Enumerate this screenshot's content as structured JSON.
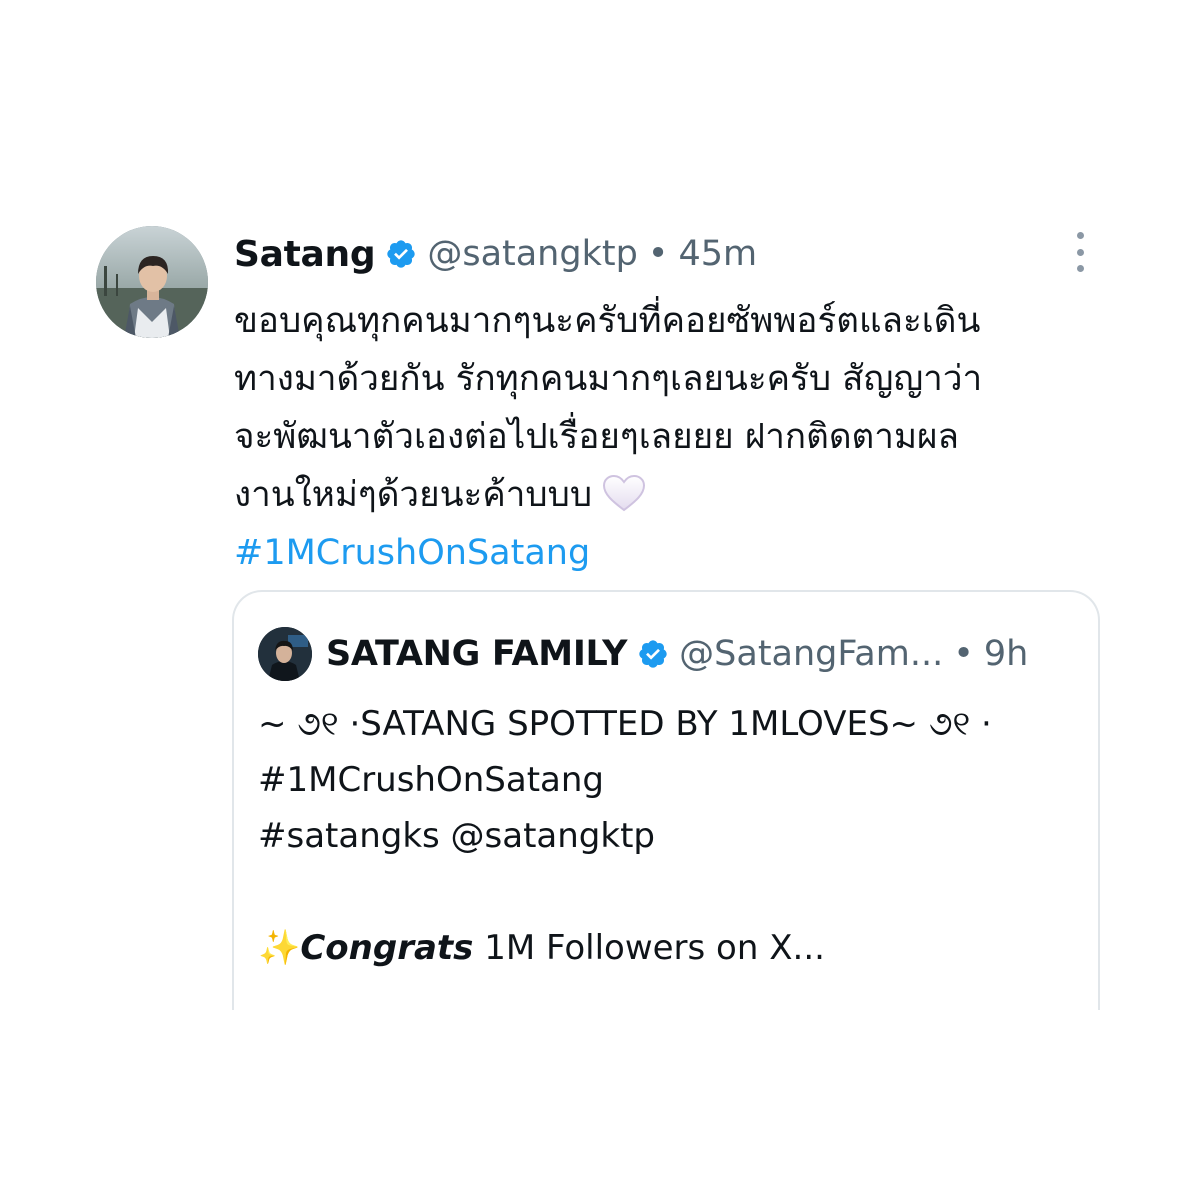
{
  "tweet": {
    "author_name": "Satang",
    "author_handle": "@satangktp",
    "separator": "•",
    "time": "45m",
    "avatar_icon": "profile-photo",
    "verified_icon": "verified-badge-icon",
    "more_icon": "more-options-icon",
    "text_lines": [
      "ขอบคุณทุกคนมากๆนะครับที่คอยซัพพอร์ตและเดิน",
      "ทางมาด้วยกัน รักทุกคนมากๆเลยนะครับ สัญญาว่า",
      "จะพัฒนาตัวเองต่อไปเรื่อยๆเลยยย ฝากติดตามผล",
      "งานใหม่ๆด้วยนะค้าบบบ"
    ],
    "emoji": "white-heart",
    "hashtag": "#1MCrushOnSatang"
  },
  "quote": {
    "author_name": "SATANG FAMILY",
    "author_handle": "@SatangFam...",
    "separator": "•",
    "time": "9h",
    "lines": [
      "~ ૭୧ ·SATANG SPOTTED BY 1MLOVES~ ૭୧ ·",
      "#1MCrushOnSatang",
      "#satangks @satangktp",
      ""
    ],
    "last_line_emoji": "✨",
    "last_line_bold": "Congrats",
    "last_line_rest": " 1M Followers on X..."
  },
  "colors": {
    "link": "#1d9bf0",
    "secondary_text": "#536471",
    "verified": "#1d9bf0",
    "border": "#e1e6ea"
  }
}
